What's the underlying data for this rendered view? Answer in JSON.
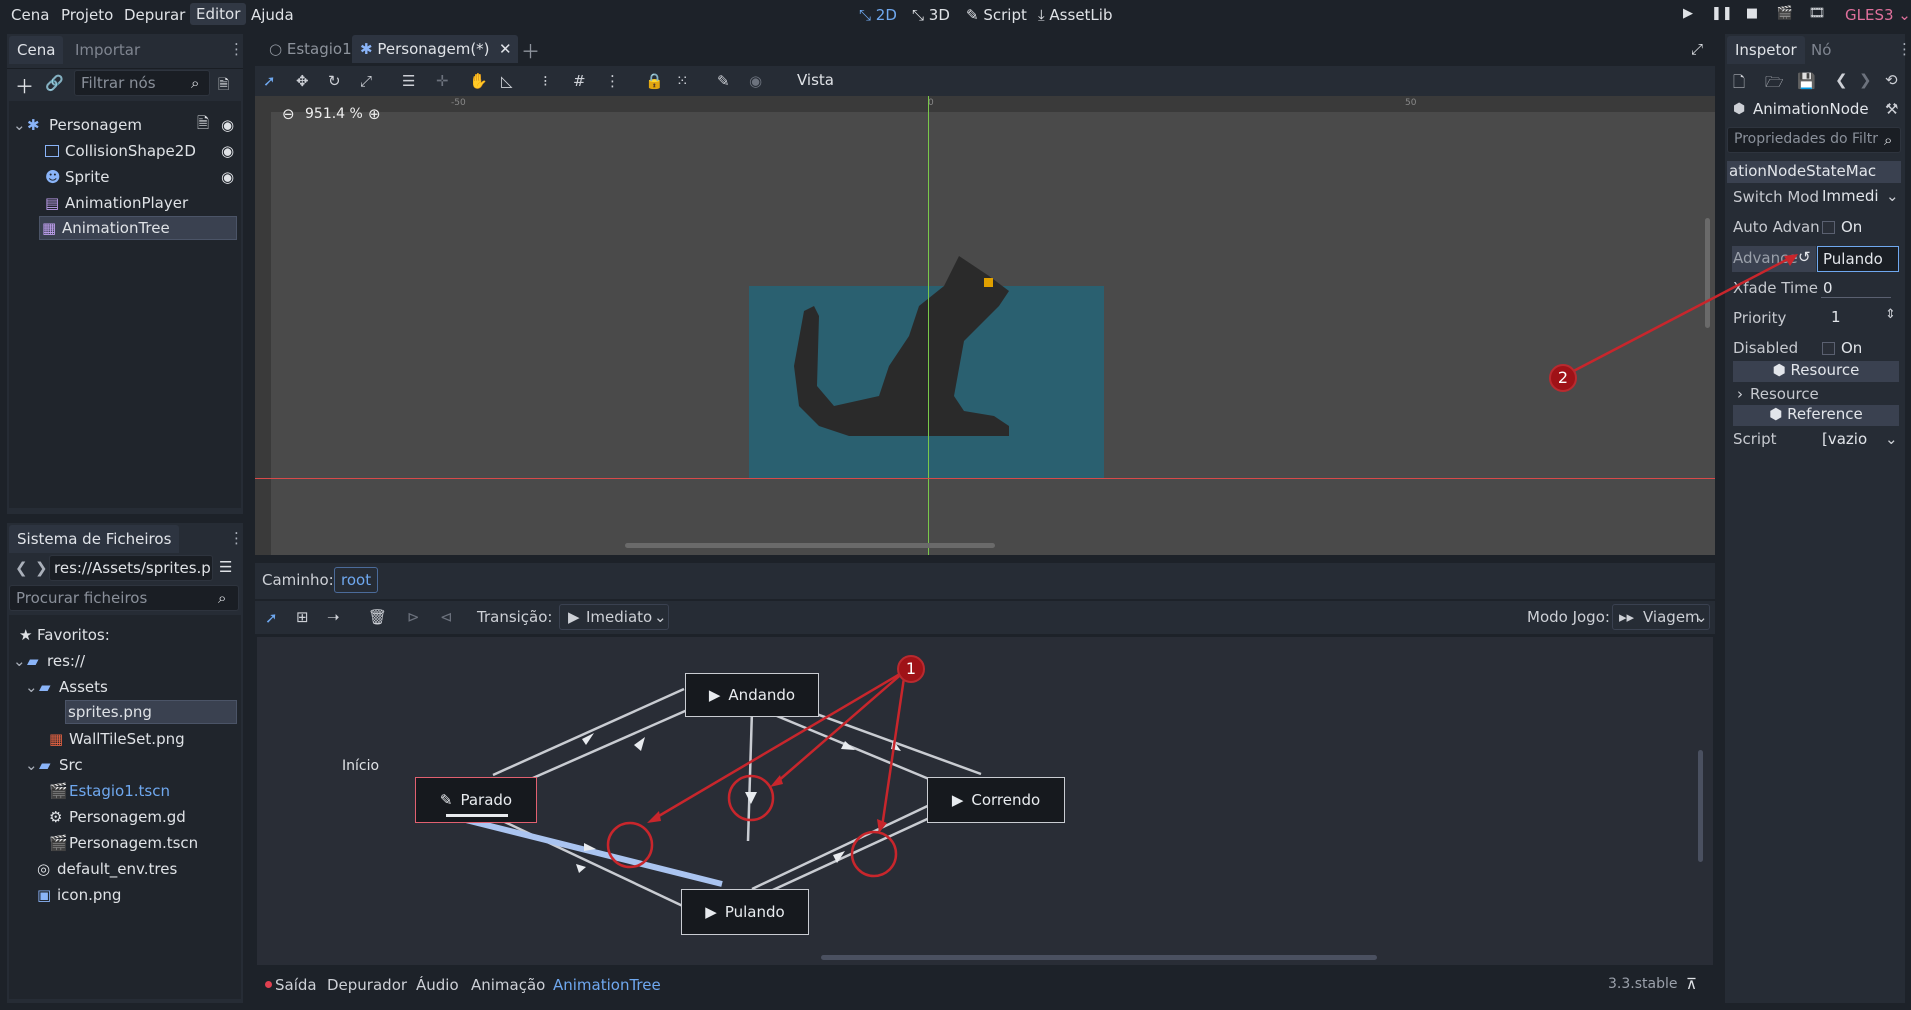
{
  "menubar": {
    "items": [
      "Cena",
      "Projeto",
      "Depurar",
      "Editor",
      "Ajuda"
    ],
    "workspaces": [
      "2D",
      "3D",
      "Script",
      "AssetLib"
    ],
    "renderer": "GLES3"
  },
  "scene_dock": {
    "tabs": [
      "Cena",
      "Importar"
    ],
    "filter_placeholder": "Filtrar nós",
    "nodes": [
      "Personagem",
      "CollisionShape2D",
      "Sprite",
      "AnimationPlayer",
      "AnimationTree"
    ]
  },
  "filesystem": {
    "title": "Sistema de Ficheiros",
    "path": "res://Assets/sprites.p",
    "search_placeholder": "Procurar ficheiros",
    "items": [
      "Favoritos:",
      "res://",
      "Assets",
      "sprites.png",
      "WallTileSet.png",
      "Src",
      "Estagio1.tscn",
      "Personagem.gd",
      "Personagem.tscn",
      "default_env.tres",
      "icon.png"
    ]
  },
  "editor_tabs": [
    "Estagio1",
    "Personagem(*)"
  ],
  "viewport": {
    "zoom": "951.4 %",
    "menu_label": "Vista",
    "ruler_labels": [
      "-50",
      "0",
      "50"
    ]
  },
  "anim_tree": {
    "path_label": "Caminho:",
    "path_value": "root",
    "transition_label": "Transição:",
    "transition_value": "Imediato",
    "play_mode_label": "Modo Jogo:",
    "play_mode_value": "Viagem",
    "start_label": "Início",
    "states": [
      "Andando",
      "Parado",
      "Correndo",
      "Pulando"
    ]
  },
  "inspector": {
    "tabs": [
      "Inspetor",
      "Nó"
    ],
    "object": "AnimationNode",
    "filter_placeholder": "Propriedades do Filtr",
    "class_header": "ationNodeStateMac",
    "props": {
      "switch_label": "Switch Mod",
      "switch_value": "Immedi",
      "auto_label": "Auto Advan",
      "auto_value": "On",
      "advance_label": "Advance",
      "advance_value": "Pulando",
      "xfade_label": "Xfade Time",
      "xfade_value": "0",
      "priority_label": "Priority",
      "priority_value": "1",
      "disabled_label": "Disabled",
      "disabled_value": "On"
    },
    "resource_header": "Resource",
    "resource_item": "Resource",
    "reference_header": "Reference",
    "script_label": "Script",
    "script_value": "[vazio"
  },
  "bottom_panel": {
    "tabs": [
      "Saída",
      "Depurador",
      "Áudio",
      "Animação",
      "AnimationTree"
    ],
    "version": "3.3.stable"
  },
  "annotations": [
    "1",
    "2"
  ],
  "colors": {
    "accent": "#6fa8ef",
    "renderer": "#e0709c",
    "callout": "#9f1217",
    "sprite_bg": "#2a6070"
  }
}
